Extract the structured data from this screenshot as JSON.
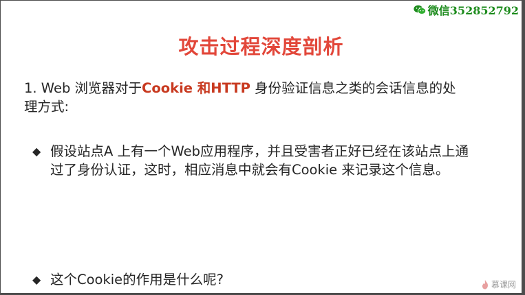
{
  "watermark": {
    "label": "微信352852792",
    "icon": "wechat-icon"
  },
  "slide": {
    "title": "攻击过程深度剖析",
    "intro": {
      "prefix": "1. Web 浏览器对于",
      "highlight": "Cookie 和HTTP",
      "suffix": " 身份验证信息之类的会话信息的处理方式:"
    },
    "bullets": [
      "假设站点A 上有一个Web应用程序，并且受害者正好已经在该站点上通过了身份认证，这时，相应消息中就会有Cookie 来记录这个信息。",
      "这个Cookie的作用是什么呢?"
    ],
    "bullet_symbol": "◆"
  },
  "brand": {
    "label": "慕课网",
    "icon": "flame-logo-icon"
  },
  "colors": {
    "title": "#e2473a",
    "highlight": "#c8391f",
    "watermark": "#1c8b1c"
  }
}
